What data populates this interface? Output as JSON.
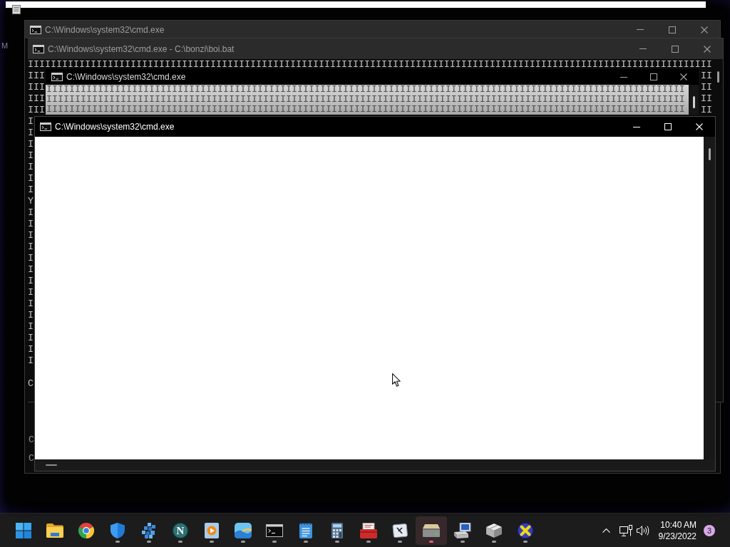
{
  "desktop": {
    "edge_text": "M"
  },
  "windows": [
    {
      "title": "C:\\Windows\\system32\\cmd.exe",
      "active": false,
      "console_lines": [
        [
          "C"
        ],
        [
          "C"
        ]
      ]
    },
    {
      "title": "C:\\Windows\\system32\\cmd.exe - C:\\bonzi\\boi.bat",
      "active": false,
      "console_lines": [
        [
          "IIIIIIIIIIIIIIIIIIIIIIIIIIIIIIIIIIIIIIIIIIIIIIIIIIIIIIIIIIIIIIIIIIIIIIIIIIIIIIIIIIIIIIIIIIIIIIIIIIIIIIIIIIIIIIIIIIIIIIII"
        ],
        [
          "III",
          "II"
        ],
        [
          "III",
          "II"
        ],
        [
          "III",
          "II"
        ],
        [
          "III",
          "II"
        ],
        [
          "I"
        ],
        [
          "I"
        ],
        [
          "I"
        ],
        [
          "I"
        ],
        [
          "I"
        ],
        [
          "I"
        ],
        [
          "I"
        ],
        [
          "Y"
        ],
        [
          "I"
        ],
        [
          "I"
        ],
        [
          "I"
        ],
        [
          "I"
        ],
        [
          "I"
        ],
        [
          "I"
        ],
        [
          "I"
        ],
        [
          "I"
        ],
        [
          "I"
        ],
        [
          "I"
        ],
        [
          "I"
        ],
        [
          "I"
        ],
        [
          "I"
        ],
        [
          "I"
        ]
      ],
      "console_lines_lower": [
        [
          "C"
        ]
      ]
    },
    {
      "title": "C:\\Windows\\system32\\cmd.exe",
      "active": true,
      "console_lines": [
        [
          "IIIIIIIIIIIIIIIIIIIIIIIIIIIIIIIIIIIIIIIIIIIIIIIIIIIIIIIIIIIIIIIIIIIIIIIIIIIIIIIIIIIIIIIIIIIIIIIIIIIIIIIIIIIIIIII"
        ],
        [
          "IIIIIIIIIIIIIIIIIIIIIIIIIIIIIIIIIIIIIIIIIIIIIIIIIIIIIIIIIIIIIIIIIIIIIIIIIIIIIIIIIIIIIIIIIIIIIIIIIIIIIIIIIIIIIIII"
        ],
        [
          "IIIIIIIIIIIIIIIIIIIIIIIIIIIIIIIIIIIIIIIIIIIIIIIIIIIIIIIIIIIIIIIIIIIIIIIIIIIIIIIIIIIIIIIIIIIIIIIIIIIIIIIIIIIIIIII"
        ]
      ]
    },
    {
      "title": "C:\\Windows\\system32\\cmd.exe",
      "active": true
    }
  ],
  "taskbar": {
    "apps": [
      {
        "kind": "folder",
        "running": false,
        "selected": false
      },
      {
        "kind": "wheel",
        "running": false,
        "selected": false
      },
      {
        "kind": "shield",
        "running": true,
        "selected": false
      },
      {
        "kind": "cubes",
        "running": true,
        "selected": false
      },
      {
        "kind": "globe",
        "glyph": "N",
        "running": true,
        "selected": false
      },
      {
        "kind": "player",
        "running": true,
        "selected": false
      },
      {
        "kind": "photos",
        "running": true,
        "selected": false
      },
      {
        "kind": "terminal",
        "running": true,
        "selected": false
      },
      {
        "kind": "notepad",
        "running": true,
        "selected": false
      },
      {
        "kind": "calculator",
        "running": true,
        "selected": false
      },
      {
        "kind": "toolbox",
        "running": true,
        "selected": false
      },
      {
        "kind": "card",
        "running": true,
        "selected": false
      },
      {
        "kind": "scanner",
        "running": true,
        "selected": true
      },
      {
        "kind": "computer",
        "running": true,
        "selected": false
      },
      {
        "kind": "package",
        "running": true,
        "selected": false
      },
      {
        "kind": "cross",
        "running": true,
        "selected": false
      }
    ],
    "clock": {
      "time": "10:40 AM",
      "date": "9/23/2022"
    },
    "notification_count": "3"
  }
}
